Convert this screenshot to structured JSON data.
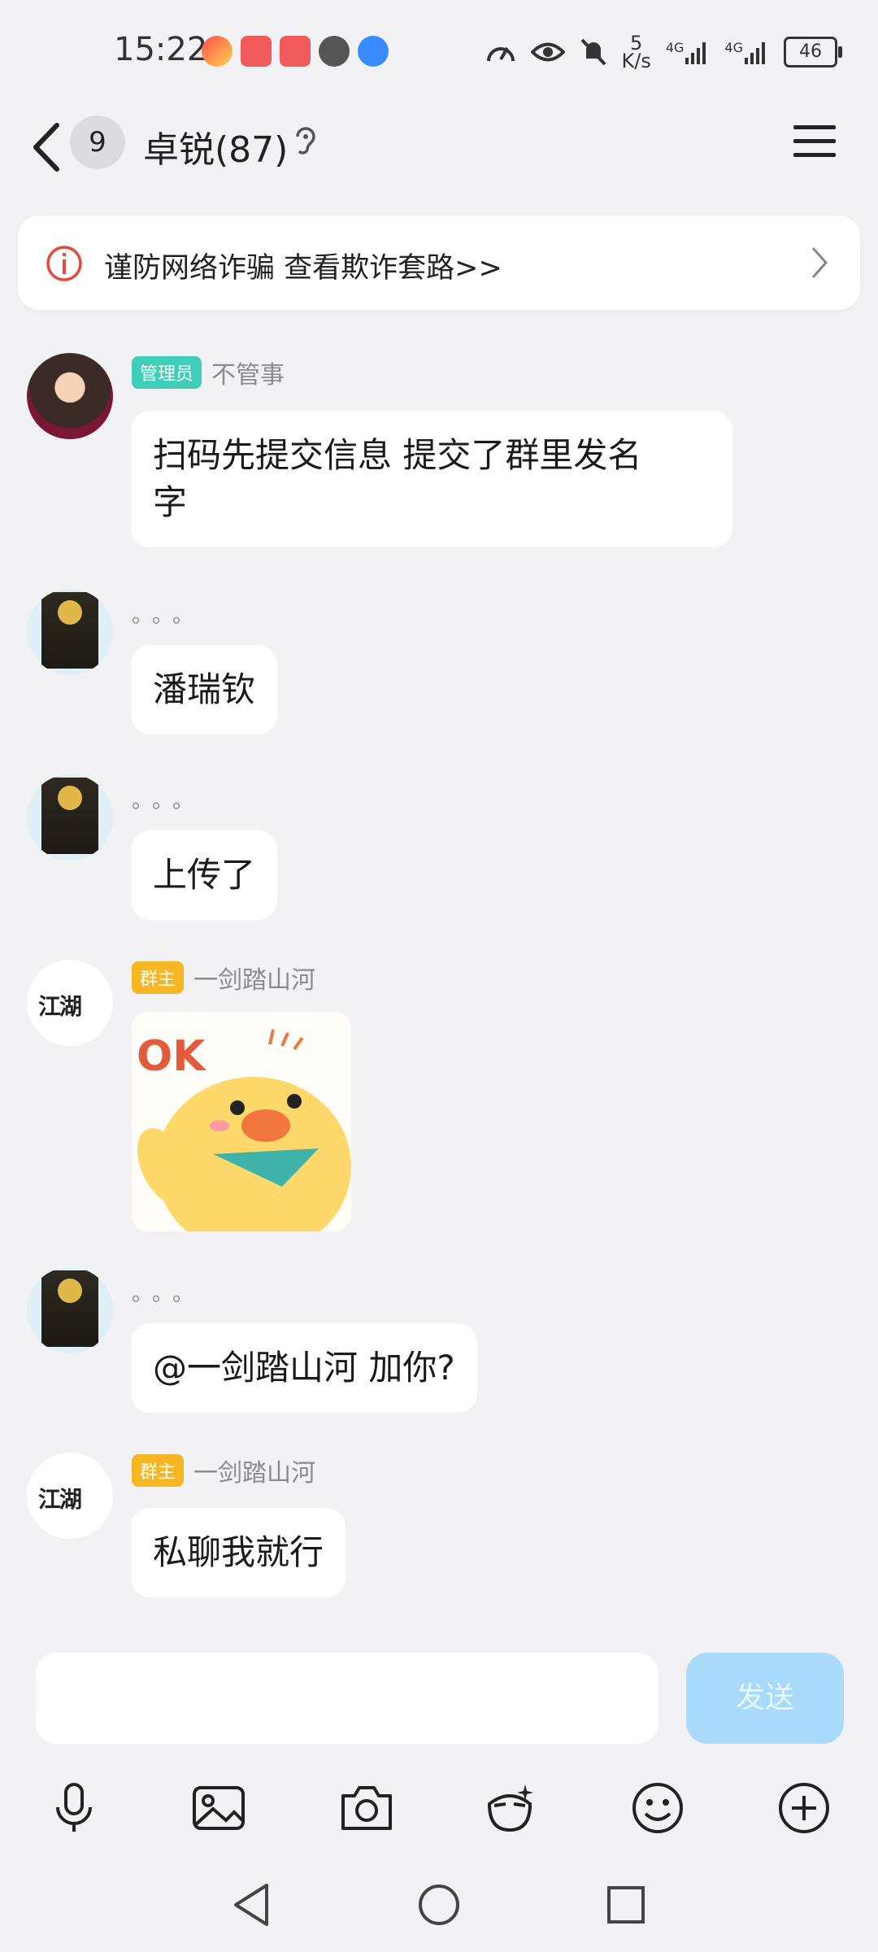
{
  "status_bar": {
    "time": "15:22",
    "net_speed_value": "5",
    "net_speed_unit": "K/s",
    "network_1": "4G",
    "network_2": "4G",
    "battery": "46"
  },
  "header": {
    "unread_count": "9",
    "title": "卓锐(87)"
  },
  "banner": {
    "text": "谨防网络诈骗 查看欺诈套路>>"
  },
  "messages": [
    {
      "role_tag": "管理员",
      "sender": "不管事",
      "text_line1": "扫码先提交信息 提交了群里发名",
      "text_line2": "字"
    },
    {
      "sender": "。。。",
      "text": "潘瑞钦"
    },
    {
      "sender": "。。。",
      "text": "上传了"
    },
    {
      "role_tag": "群主",
      "sender": "一剑踏山河",
      "sticker_text": "OK"
    },
    {
      "sender": "。。。",
      "text": "@一剑踏山河 加你?"
    },
    {
      "role_tag": "群主",
      "sender": "一剑踏山河",
      "text": "私聊我就行"
    }
  ],
  "input": {
    "send_label": "发送"
  },
  "colors": {
    "background": "#f2f2f4",
    "admin_tag": "#3fcfb8",
    "owner_tag": "#f7b623",
    "send_button": "#a9d9fb"
  }
}
